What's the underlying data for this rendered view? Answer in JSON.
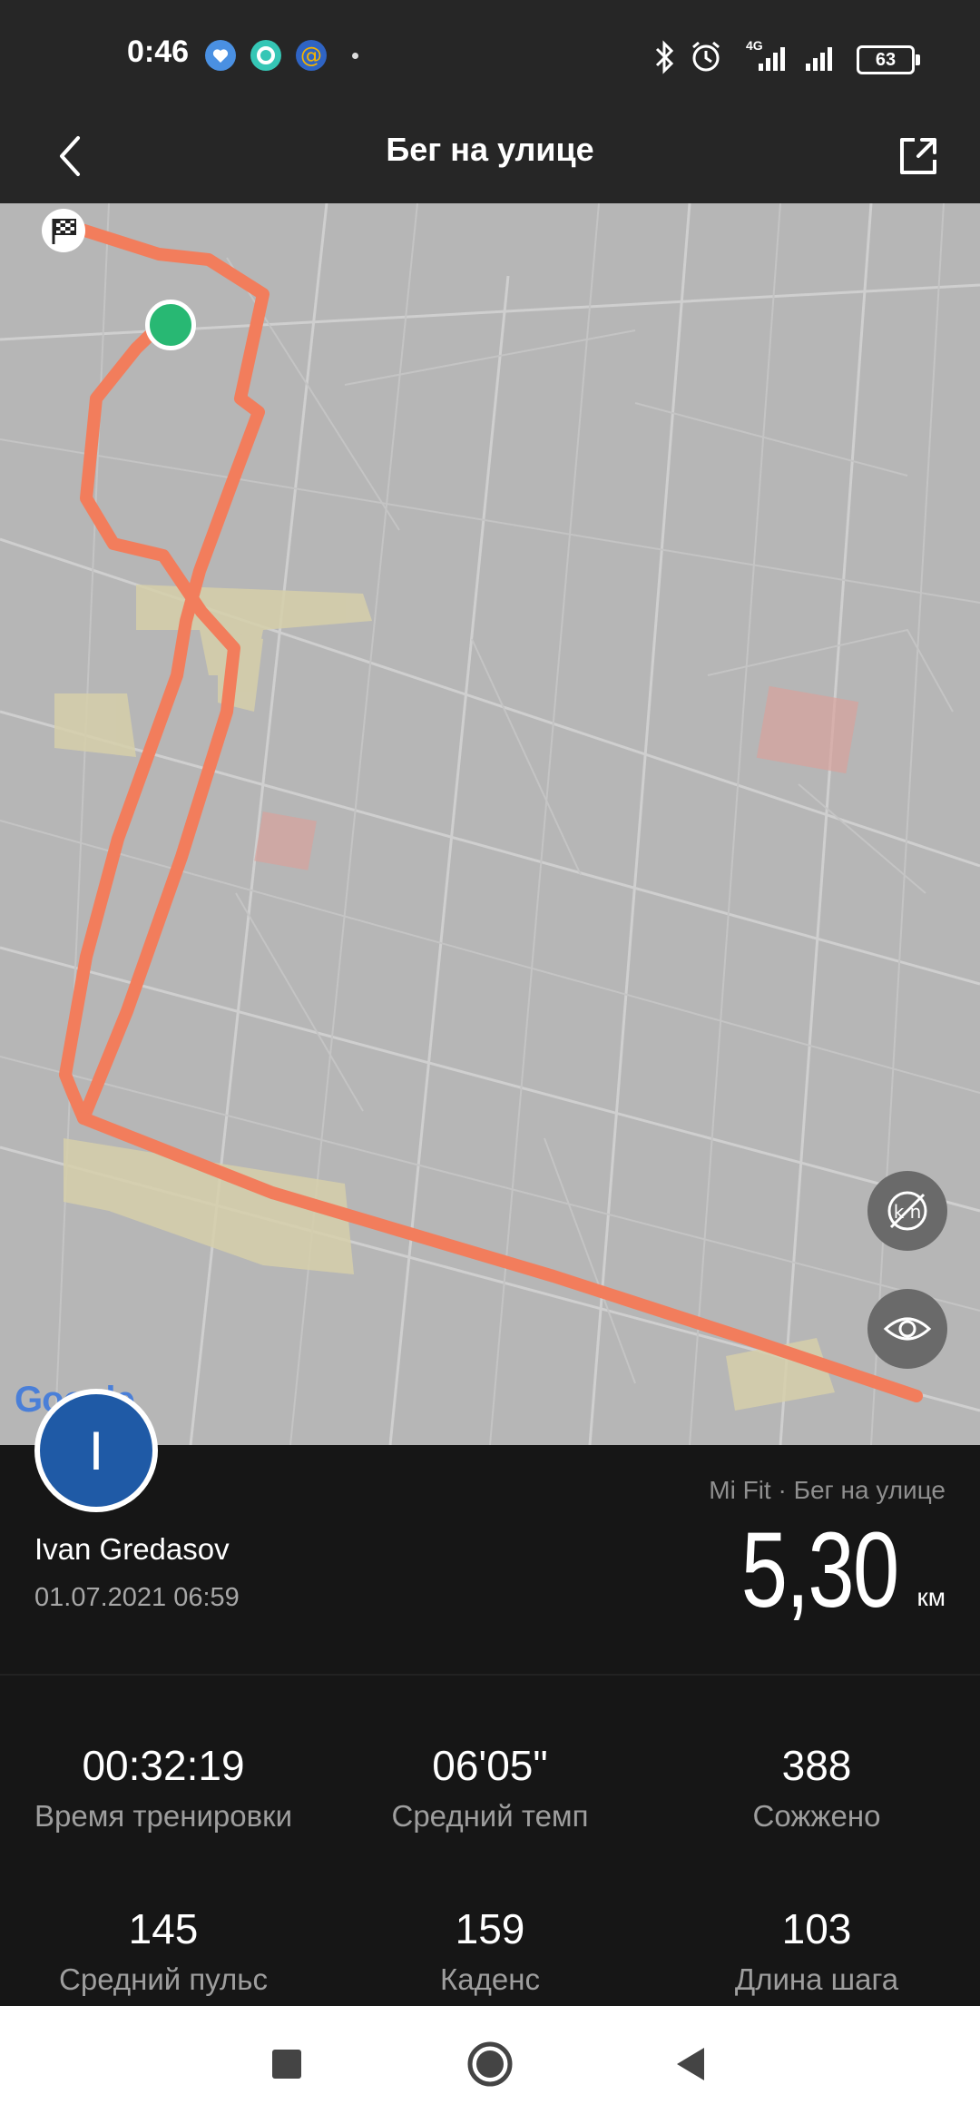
{
  "status_bar": {
    "time": "0:46",
    "notification_icons": [
      "heart-app-icon",
      "circle-app-icon",
      "mail-at-icon",
      "dot-icon"
    ],
    "right_icons": [
      "bluetooth-icon",
      "alarm-icon",
      "signal-4g-icon",
      "signal-icon",
      "battery-icon"
    ],
    "network_label": "4G",
    "battery_percent": "63"
  },
  "header": {
    "title": "Бег на улице",
    "back_icon": "back-arrow-icon",
    "share_icon": "share-icon"
  },
  "map": {
    "route_color": "#f27d5c",
    "start_color": "#28b873",
    "finish_icon": "checkered-flag-icon",
    "buttons": [
      "km-markers-off-icon",
      "eye-icon"
    ],
    "attribution": "Google"
  },
  "workout": {
    "avatar_letter": "I",
    "user_name": "Ivan Gredasov",
    "datetime": "01.07.2021 06:59",
    "source": "Mi Fit · Бег на улице",
    "distance": "5,30",
    "distance_unit": "км"
  },
  "stats": [
    {
      "value": "00:32:19",
      "label": "Время тренировки"
    },
    {
      "value": "06'05\"",
      "label": "Средний темп"
    },
    {
      "value": "388",
      "label": "Сожжено"
    },
    {
      "value": "145",
      "label": "Средний пульс"
    },
    {
      "value": "159",
      "label": "Каденс"
    },
    {
      "value": "103",
      "label": "Длина шага"
    }
  ],
  "navbar": {
    "buttons": [
      "recent-apps-icon",
      "home-icon",
      "back-triangle-icon"
    ]
  }
}
